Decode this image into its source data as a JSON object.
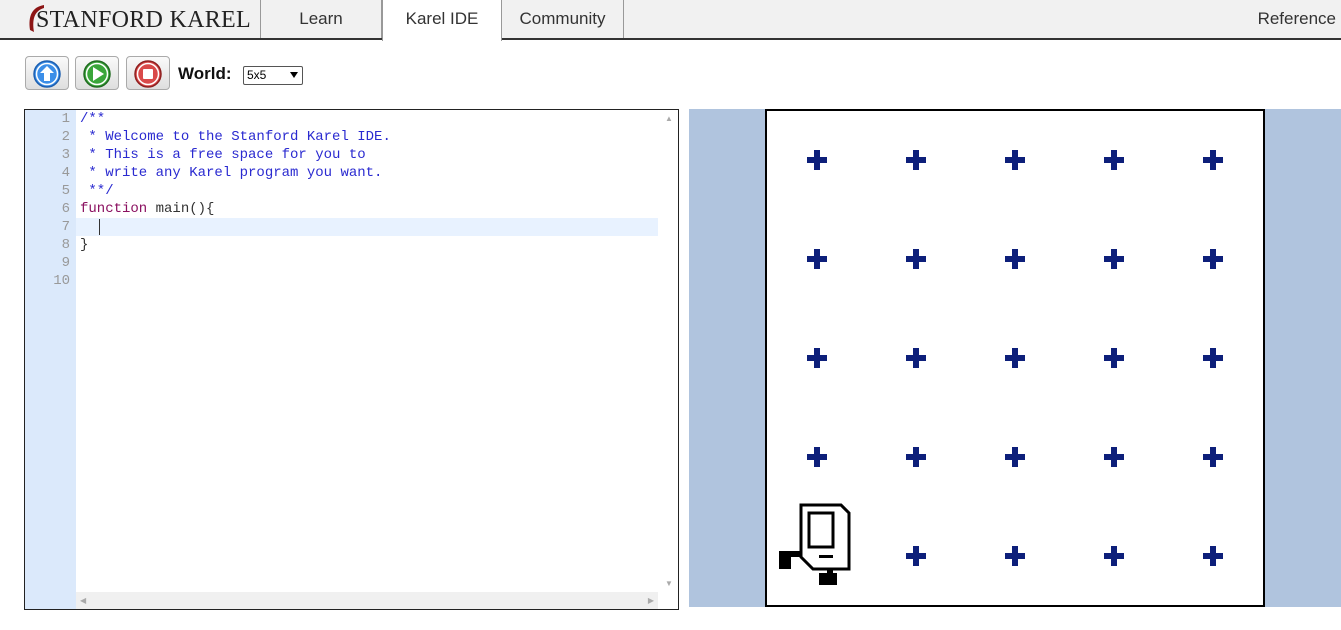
{
  "nav": {
    "brand": "STANFORD KAREL",
    "tabs": [
      {
        "label": "Learn"
      },
      {
        "label": "Karel IDE",
        "active": true
      },
      {
        "label": "Community"
      }
    ],
    "reference": "Reference"
  },
  "toolbar": {
    "world_label": "World:",
    "world_value": "5x5",
    "buttons": [
      "up-icon",
      "run-icon",
      "stop-icon"
    ]
  },
  "editor": {
    "line_numbers": [
      "1",
      "2",
      "3",
      "4",
      "5",
      "6",
      "7",
      "8",
      "9",
      "10"
    ],
    "lines": [
      "/**",
      " * Welcome to the Stanford Karel IDE.",
      " * This is a free space for you to",
      " * write any Karel program you want.",
      " **/",
      "function main(){",
      "   ",
      "}",
      "",
      ""
    ],
    "active_line": 7
  },
  "world": {
    "rows": 5,
    "cols": 5,
    "karel_position": {
      "row": 1,
      "col": 1
    },
    "karel_facing": "east",
    "colors": {
      "background": "#b0c4de",
      "corner_marker": "#0d1f7a"
    }
  }
}
